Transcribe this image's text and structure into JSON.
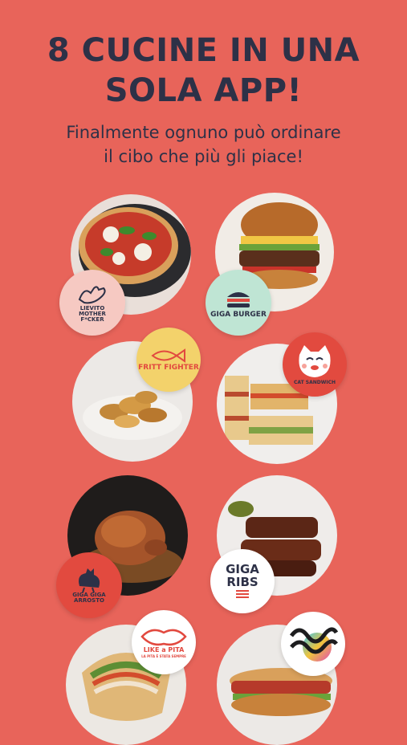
{
  "header": {
    "title_line1": "8 CUCINE IN UNA",
    "title_line2": "SOLA APP!",
    "subtitle_line1": "Finalmente ognuno può ordinare",
    "subtitle_line2": "il cibo che più gli piace!"
  },
  "brands": [
    {
      "id": "lievito-mother-fucker",
      "label": "LIEVITO MOTHER F*CKER",
      "icon": "hand-icon"
    },
    {
      "id": "giga-burger",
      "label": "GIGA BURGER",
      "icon": "burger-icon"
    },
    {
      "id": "fritt-fighter",
      "label": "FRITT FIGHTER",
      "icon": "fish-icon"
    },
    {
      "id": "cat-sandwich",
      "label": "CAT SANDWICH",
      "icon": "cat-face-icon"
    },
    {
      "id": "giga-giga-arrosto",
      "label": "GIGA GIGA ARROSTO",
      "icon": "rooster-icon"
    },
    {
      "id": "giga-ribs",
      "label": "GIGA RIBS",
      "icon": "ribs-icon"
    },
    {
      "id": "like-a-pita",
      "label": "LIKE a PITA",
      "sublabel": "LA PITA È STATA SEMPRE",
      "icon": "lips-icon"
    },
    {
      "id": "wave-brand",
      "label": "",
      "icon": "wave-logo-icon"
    }
  ],
  "colors": {
    "background": "#e8645a",
    "text": "#2d3147",
    "badge_pink": "#f6c9c2",
    "badge_mint": "#bfe5d4",
    "badge_yellow": "#f3d26b",
    "badge_red": "#e24a3f",
    "badge_white": "#ffffff"
  }
}
